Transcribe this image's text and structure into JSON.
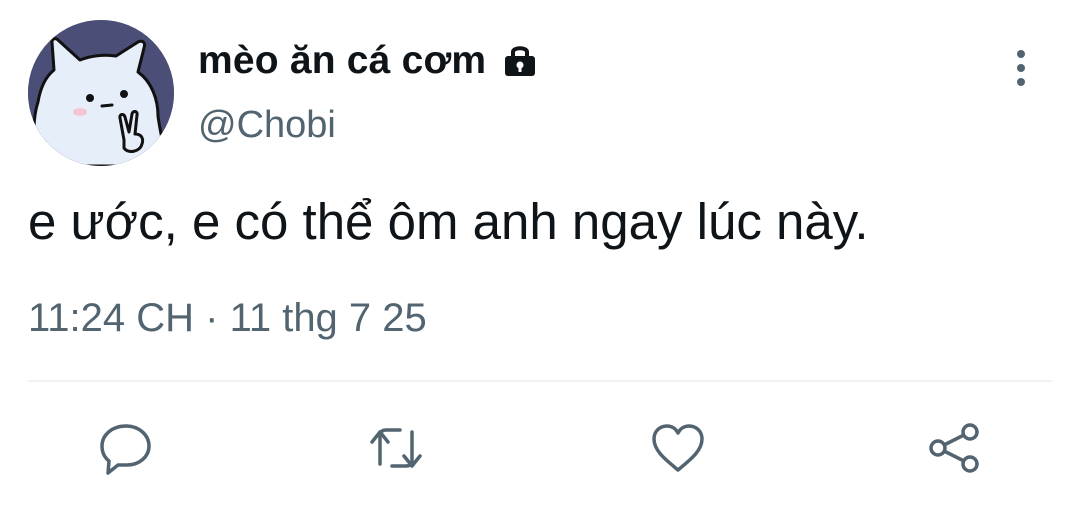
{
  "user": {
    "display_name": "mèo ăn cá cơm",
    "handle": "@Chobi",
    "protected_icon": "lock-icon",
    "avatar_icon": "cat-avatar"
  },
  "tweet": {
    "text": "e ước, e có thể ôm anh ngay lúc này.",
    "timestamp": "11:24 CH · 11 thg 7 25"
  },
  "actions": [
    {
      "icon": "reply-icon"
    },
    {
      "icon": "retweet-icon"
    },
    {
      "icon": "like-icon"
    },
    {
      "icon": "share-icon"
    }
  ],
  "menu_icon": "more-vertical-icon",
  "colors": {
    "text_primary": "#0f1419",
    "text_secondary": "#536471",
    "divider": "#eff3f4",
    "avatar_background": "#4b4f78"
  }
}
